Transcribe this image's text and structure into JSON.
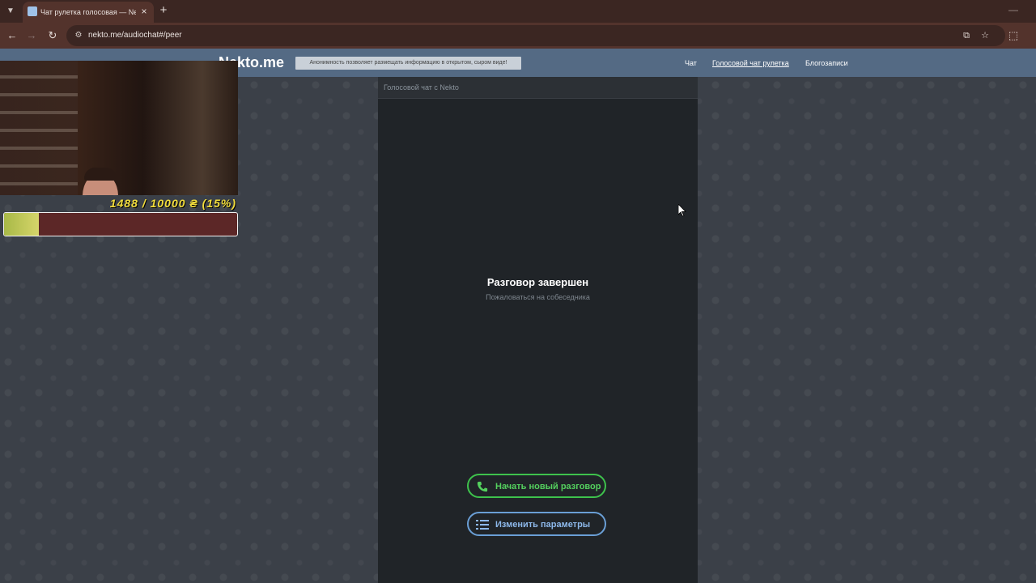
{
  "browser": {
    "tab_title": "Чат рулетка голосовая — Nekto",
    "url": "nekto.me/audiochat#/peer",
    "icons": {
      "tab_dropdown": "chevron-down-icon",
      "favicon": "favicon-icon",
      "close": "close-icon",
      "new_tab": "plus-icon",
      "back": "back-arrow-icon",
      "forward": "forward-arrow-icon",
      "reload": "reload-icon",
      "site_info": "site-info-icon",
      "install": "install-app-icon",
      "bookmark": "star-icon",
      "extensions": "extensions-icon",
      "minimize": "minimize-icon"
    }
  },
  "site": {
    "logo": "Nekto.me",
    "notice": "Анонимность позволяет размещать информацию в открытом, сыром виде!",
    "menu": [
      {
        "label": "Чат",
        "active": false
      },
      {
        "label": "Голосовой чат рулетка",
        "active": true
      },
      {
        "label": "Блогозаписи",
        "active": false
      }
    ]
  },
  "chat": {
    "header": "Голосовой чат с Nekto",
    "end_title": "Разговор завершен",
    "report_link": "Пожаловаться на собеседника",
    "buttons": {
      "new_chat": "Начать новый разговор",
      "params": "Изменить параметры"
    },
    "colors": {
      "new_chat": "#3ec24c",
      "params": "#6a9fd6"
    }
  },
  "overlay": {
    "donation_text": "1488 / 10000 ₴ (15%)",
    "progress": 0.15,
    "progress_fill_color": "#c4cb5b",
    "progress_bg_color": "#5c2727"
  }
}
